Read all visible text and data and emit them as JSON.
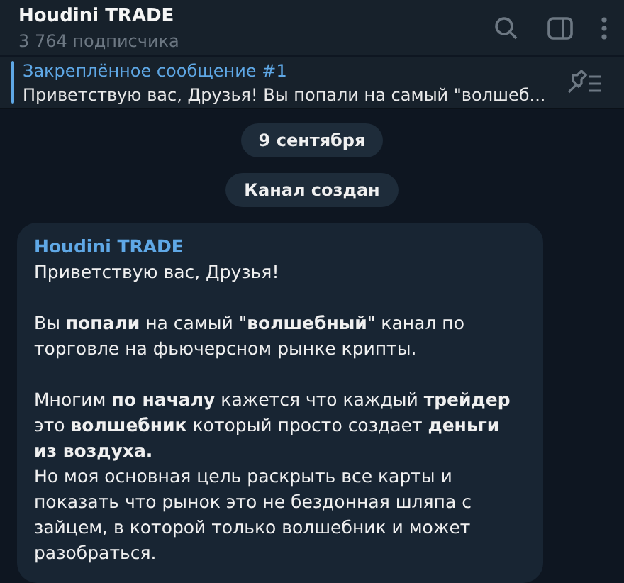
{
  "header": {
    "title": "Houdini TRADE",
    "subtitle": "3 764 подписчика"
  },
  "pinned": {
    "label": "Закреплённое сообщение #1",
    "text": "Приветствую вас, Друзья!  Вы попали на самый \"волшеб..."
  },
  "service": [
    {
      "kind": "date",
      "text": "9 сентября"
    },
    {
      "kind": "event",
      "text": "Канал создан"
    }
  ],
  "message": {
    "author": "Houdini TRADE",
    "paragraphs": [
      "Приветствую вас, Друзья!",
      "Вы **попали** на самый \"**волшебный**\" канал по торговле на фьючерсном рынке крипты.",
      "Многим **по началу** кажется что каждый **трейдер** это **волшебник** который просто создает **деньги из воздуха.**\nНо моя основная цель раскрыть все карты и показать что рынок это не бездонная шляпа с зайцем, в которой только волшебник и может разобраться."
    ]
  }
}
